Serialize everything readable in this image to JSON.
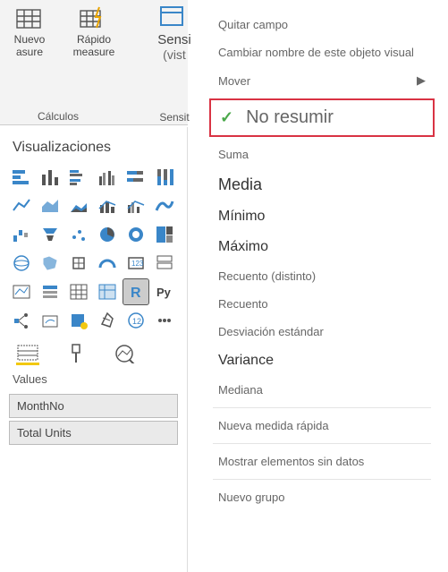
{
  "ribbon": {
    "new_label": "Nuevo",
    "quick_label": "Rápido",
    "sub1": "asure",
    "sub2": "measure",
    "group": "Cálculos",
    "sens_label": "Sensi",
    "sens_sub": "(vist",
    "sens_group": "Sensit"
  },
  "viz": {
    "title": "Visualizaciones",
    "section": "Values",
    "fields": [
      "MonthNo",
      "Total Units"
    ]
  },
  "ctx": {
    "quitar": "Quitar campo",
    "rename": "Cambiar nombre de este objeto visual",
    "mover": "Mover",
    "no_resumir": "No resumir",
    "suma": "Suma",
    "media": "Media",
    "minimo": "Mínimo",
    "maximo": "Máximo",
    "recuento_d": "Recuento (distinto)",
    "recuento": "Recuento",
    "desv": "Desviación estándar",
    "variance": "Variance",
    "mediana": "Mediana",
    "quick_measure": "Nueva medida rápida",
    "show_no_data": "Mostrar elementos sin datos",
    "new_group": "Nuevo grupo"
  }
}
